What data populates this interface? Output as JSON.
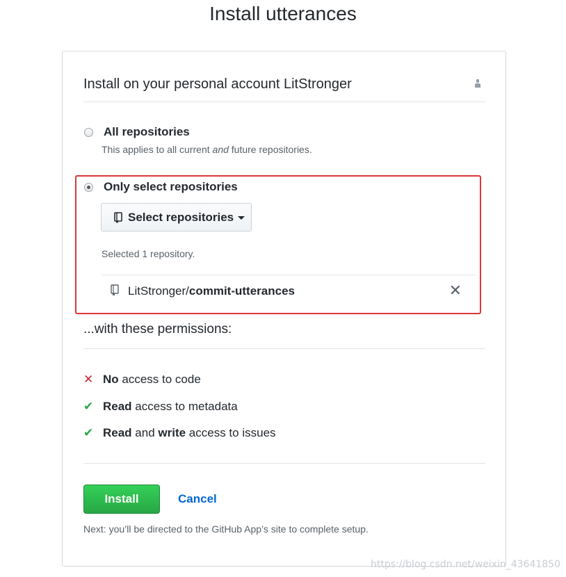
{
  "page": {
    "title": "Install utterances"
  },
  "account": {
    "title": "Install on your personal account LitStronger",
    "icon": "person-icon"
  },
  "options": {
    "all": {
      "label": "All repositories",
      "note_prefix": "This applies to all current ",
      "note_emphasis": "and",
      "note_suffix": " future repositories.",
      "checked": false
    },
    "select": {
      "label": "Only select repositories",
      "checked": true
    }
  },
  "repo_picker": {
    "button_label": "Select repositories",
    "selected_count": "Selected 1 repository.",
    "repo_owner": "LitStronger/",
    "repo_name": "commit-utterances",
    "remove_glyph": "✕"
  },
  "permissions": {
    "heading": "...with these permissions:",
    "items": [
      {
        "icon": "x-icon",
        "glyph": "✕",
        "strong": "No",
        "text": " access to code",
        "status": "denied"
      },
      {
        "icon": "check-icon",
        "glyph": "✔",
        "strong": "Read",
        "text": " access to metadata",
        "status": "granted"
      },
      {
        "icon": "check-icon",
        "glyph": "✔",
        "strong_a": "Read",
        "mid": " and ",
        "strong_b": "write",
        "text": " access to issues",
        "status": "granted"
      }
    ]
  },
  "actions": {
    "install_label": "Install",
    "cancel_label": "Cancel",
    "next_note": "Next: you’ll be directed to the GitHub App’s site to complete setup."
  },
  "watermark": "https://blog.csdn.net/weixin_43641850",
  "colors": {
    "accent_green": "#28a745",
    "link_blue": "#0366d6",
    "highlight_red": "#d9373a",
    "deny_red": "#cb2431"
  }
}
